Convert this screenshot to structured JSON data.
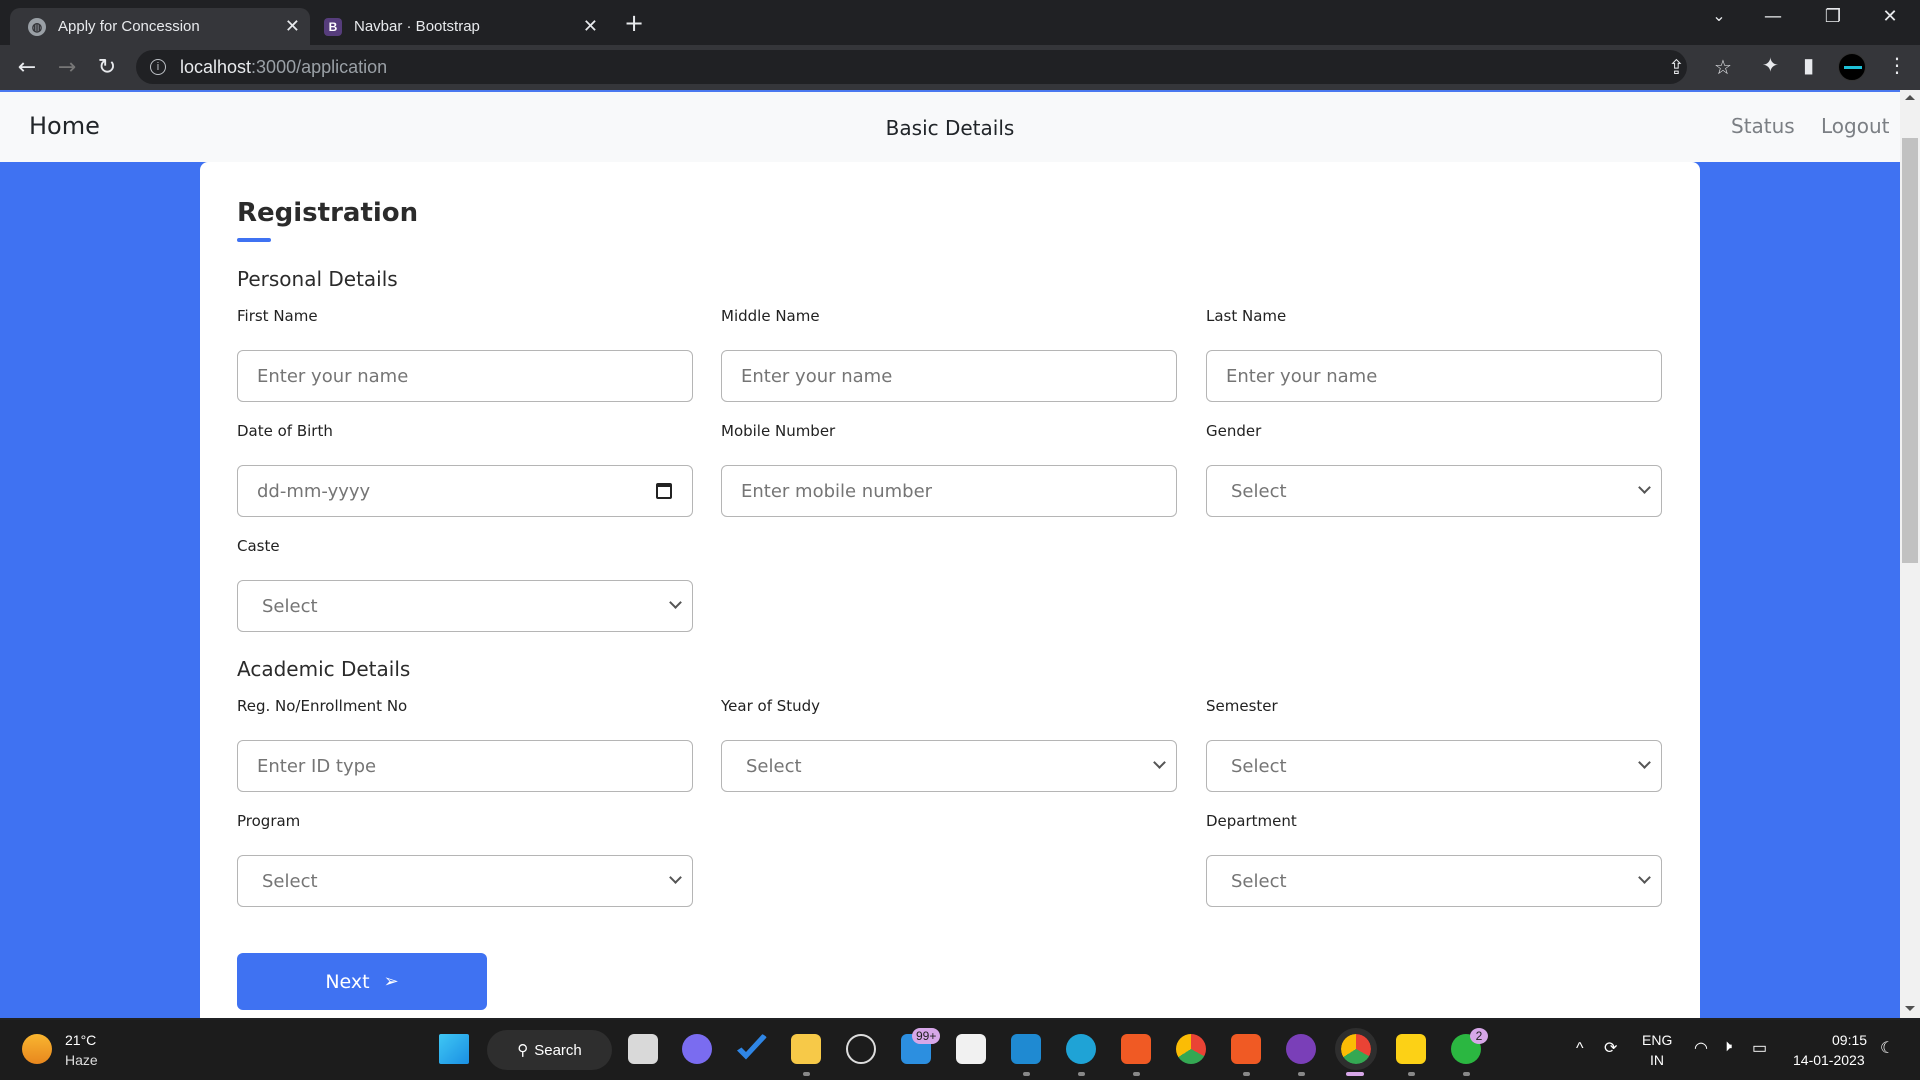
{
  "browser": {
    "tabs": [
      {
        "title": "Apply for Concession",
        "favicon": "globe-icon",
        "active": true
      },
      {
        "title": "Navbar · Bootstrap",
        "favicon": "bootstrap-icon",
        "favicon_text": "B",
        "active": false
      }
    ],
    "address": {
      "host": "localhost",
      "path": ":3000/application"
    },
    "icons": {
      "new_tab": "+",
      "back": "←",
      "forward": "→",
      "reload": "↻",
      "share": "⇪",
      "star": "☆",
      "puzzle": "✦",
      "sidepanel": "▮",
      "menu": "⋮",
      "dropdown": "⌄",
      "minimize": "—",
      "restore": "❐",
      "close": "✕",
      "tab_close": "✕",
      "info": "i"
    }
  },
  "navbar": {
    "home": "Home",
    "center": "Basic Details",
    "status": "Status",
    "logout": "Logout"
  },
  "form": {
    "title": "Registration",
    "personal_section": "Personal Details",
    "academic_section": "Academic Details",
    "fields": {
      "first_name": {
        "label": "First Name",
        "placeholder": "Enter your name"
      },
      "middle_name": {
        "label": "Middle Name",
        "placeholder": "Enter your name"
      },
      "last_name": {
        "label": "Last Name",
        "placeholder": "Enter your name"
      },
      "dob": {
        "label": "Date of Birth",
        "placeholder": "dd-mm-yyyy"
      },
      "mobile": {
        "label": "Mobile Number",
        "placeholder": "Enter mobile number"
      },
      "gender": {
        "label": "Gender",
        "value": "Select"
      },
      "caste": {
        "label": "Caste",
        "value": "Select"
      },
      "reg_no": {
        "label": "Reg. No/Enrollment No",
        "placeholder": "Enter ID type"
      },
      "year": {
        "label": "Year of Study",
        "value": "Select"
      },
      "semester": {
        "label": "Semester",
        "value": "Select"
      },
      "program": {
        "label": "Program",
        "value": "Select"
      },
      "department": {
        "label": "Department",
        "value": "Select"
      }
    },
    "next_label": "Next",
    "next_icon": "➢"
  },
  "taskbar": {
    "weather": {
      "temp": "21°C",
      "condition": "Haze"
    },
    "search_label": "Search",
    "search_icon": "⚲",
    "mail_badge": "99+",
    "whatsapp_badge": "2",
    "lang_line1": "ENG",
    "lang_line2": "IN",
    "time": "09:15",
    "date": "14-01-2023",
    "tray_up": "^",
    "wifi": "◠",
    "volume": "🕨",
    "battery": "▭",
    "moon": "☾"
  },
  "colors": {
    "accent": "#3f72f2",
    "navbar_bg": "#f8f9fa"
  }
}
